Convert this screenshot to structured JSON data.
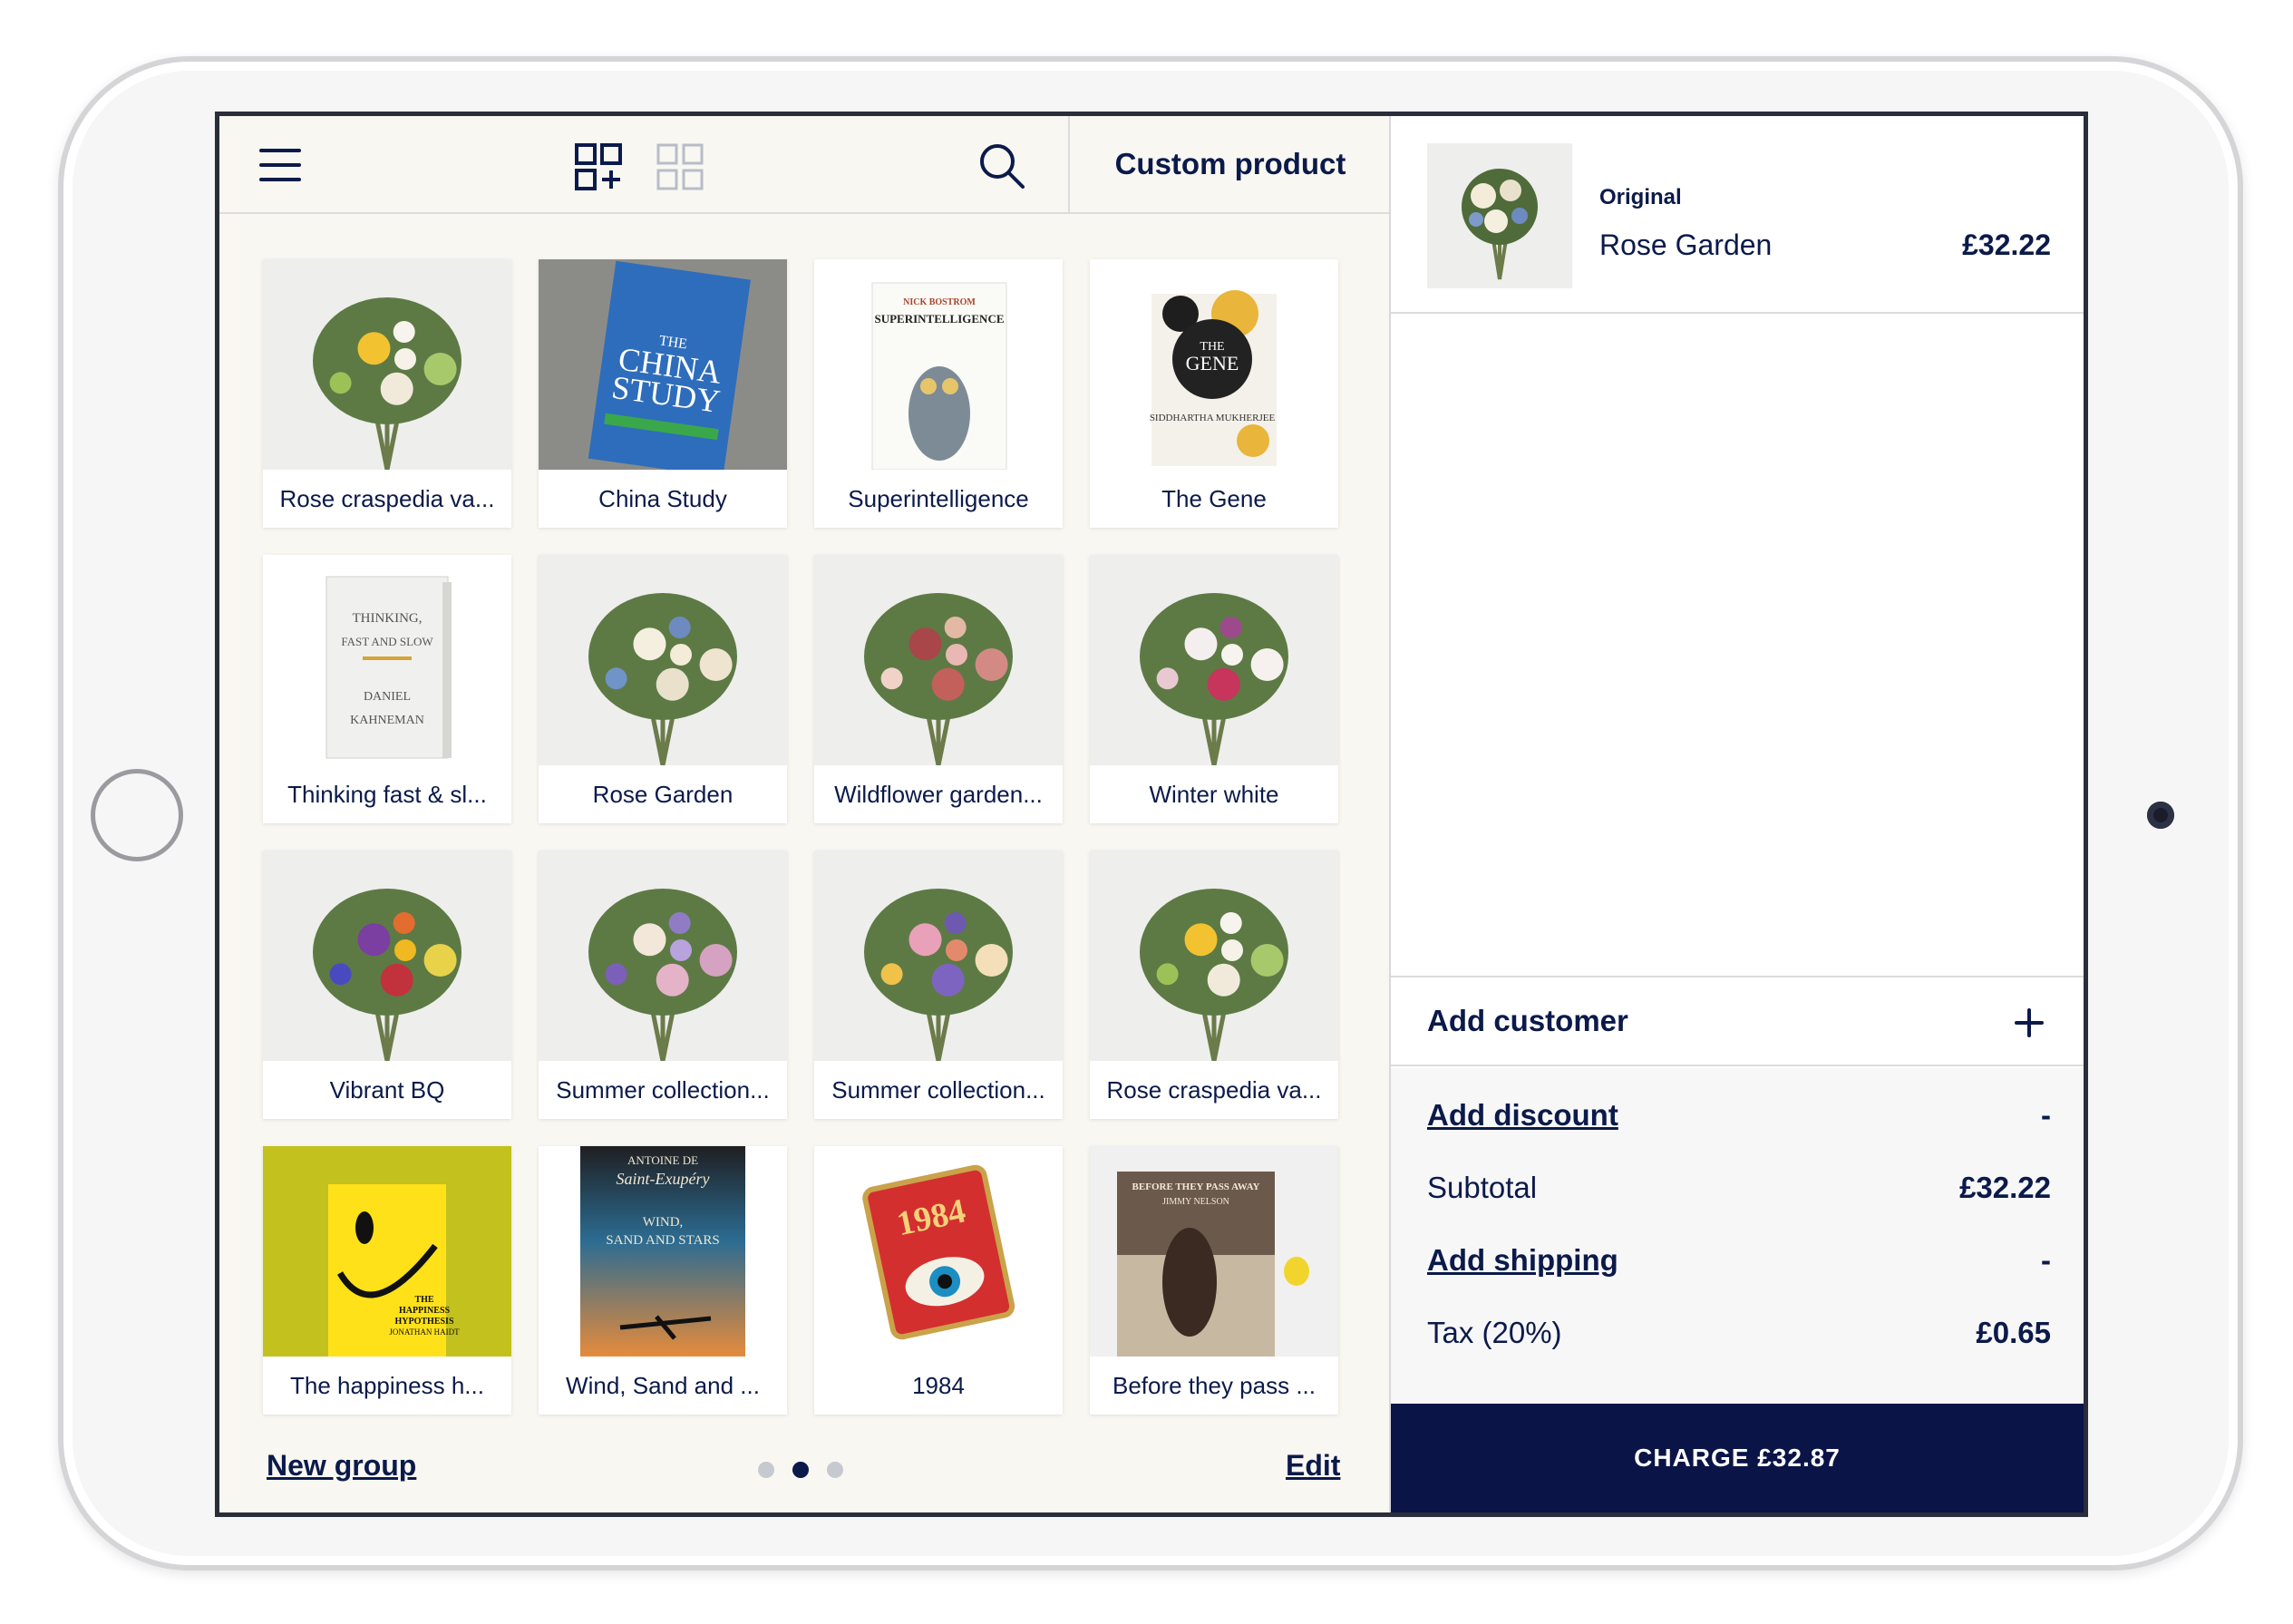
{
  "toolbar": {
    "custom_product_label": "Custom product"
  },
  "products": [
    {
      "name": "Rose craspedia va...",
      "thumb": "bouquet-white-green-icon"
    },
    {
      "name": "China Study",
      "thumb": "book-china-study-icon",
      "cover_lines": [
        "THE",
        "CHINA",
        "STUDY"
      ]
    },
    {
      "name": "Superintelligence",
      "thumb": "book-superintelligence-icon",
      "cover_lines": [
        "NICK BOSTROM",
        "SUPERINTELLIGENCE"
      ]
    },
    {
      "name": "The Gene",
      "thumb": "book-the-gene-icon",
      "cover_lines": [
        "THE",
        "GENE",
        "SIDDHARTHA MUKHERJEE"
      ]
    },
    {
      "name": "Thinking fast & sl...",
      "thumb": "book-thinking-fast-icon",
      "cover_lines": [
        "THINKING,",
        "FAST AND SLOW",
        "DANIEL",
        "KAHNEMAN"
      ]
    },
    {
      "name": "Rose Garden",
      "thumb": "bouquet-rose-garden-icon"
    },
    {
      "name": "Wildflower garden...",
      "thumb": "bouquet-wildflower-icon"
    },
    {
      "name": "Winter white",
      "thumb": "bouquet-winter-white-icon"
    },
    {
      "name": "Vibrant BQ",
      "thumb": "bouquet-vibrant-icon"
    },
    {
      "name": "Summer collection...",
      "thumb": "bouquet-summer-1-icon"
    },
    {
      "name": "Summer collection...",
      "thumb": "bouquet-summer-2-icon"
    },
    {
      "name": "Rose craspedia va...",
      "thumb": "bouquet-white-green-icon"
    },
    {
      "name": "The happiness h...",
      "thumb": "book-happiness-hypothesis-icon",
      "cover_lines": [
        "THE",
        "HAPPINESS",
        "HYPOTHESIS",
        "JONATHAN HAIDT"
      ]
    },
    {
      "name": "Wind, Sand and ...",
      "thumb": "book-wind-sand-stars-icon",
      "cover_lines": [
        "ANTOINE DE",
        "Saint-Exupéry",
        "WIND,",
        "SAND AND STARS"
      ]
    },
    {
      "name": "1984",
      "thumb": "book-1984-pin-icon",
      "cover_lines": [
        "1984"
      ]
    },
    {
      "name": "Before they pass ...",
      "thumb": "book-before-they-pass-away-icon",
      "cover_lines": [
        "BEFORE THEY PASS AWAY",
        "JIMMY NELSON"
      ]
    }
  ],
  "bottom": {
    "new_group_label": "New group",
    "edit_label": "Edit",
    "pages": 3,
    "active_page": 2
  },
  "order": {
    "variant": "Original",
    "item_name": "Rose Garden",
    "item_price": "£32.22",
    "add_customer_label": "Add customer",
    "add_discount_label": "Add discount",
    "discount_value": "-",
    "subtotal_label": "Subtotal",
    "subtotal_value": "£32.22",
    "add_shipping_label": "Add shipping",
    "shipping_value": "-",
    "tax_label": "Tax (20%)",
    "tax_value": "£0.65",
    "charge_label": "CHARGE £32.87"
  },
  "colors": {
    "navy": "#0a1446",
    "left_bg": "#f8f7f1",
    "totals_bg": "#f7f7f8"
  }
}
